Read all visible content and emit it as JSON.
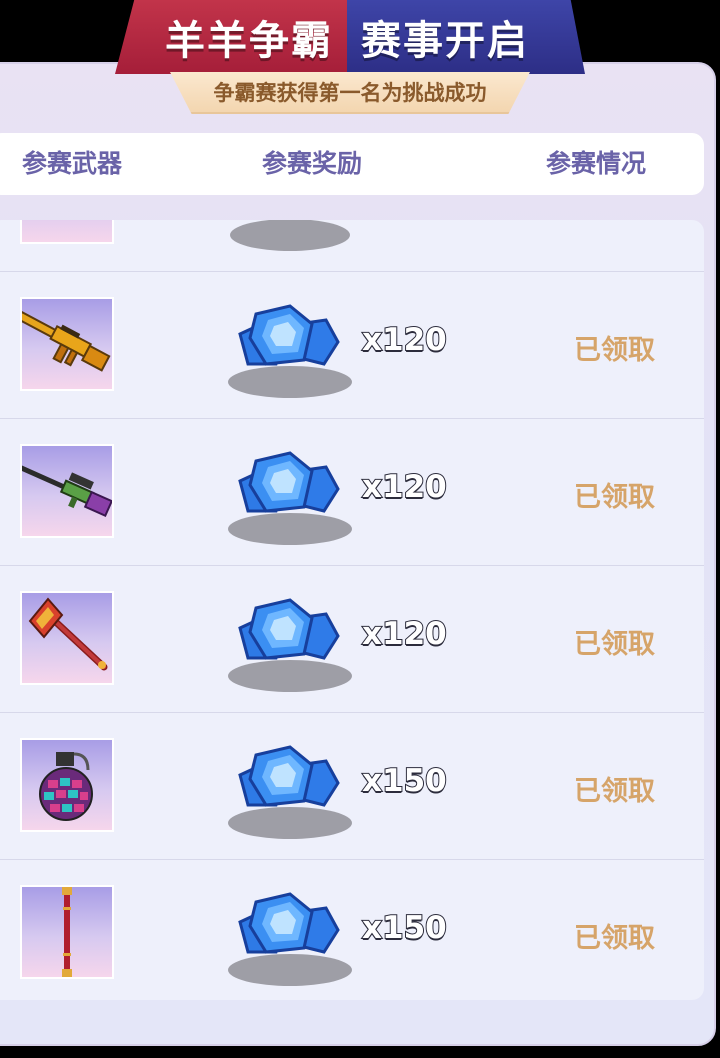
{
  "banner": {
    "title_left": "羊羊争霸",
    "title_right": "赛事开启",
    "subtitle": "争霸赛获得第一名为挑战成功"
  },
  "header": {
    "col_weapon": "参赛武器",
    "col_reward": "参赛奖励",
    "col_status": "参赛情况"
  },
  "rows": [
    {
      "weapon": "rifle-icon",
      "reward_icon": "blue-gem-icon",
      "quantity": "x120",
      "status": "已领取"
    },
    {
      "weapon": "sniper-rifle-icon",
      "reward_icon": "blue-gem-icon",
      "quantity": "x120",
      "status": "已领取"
    },
    {
      "weapon": "axe-icon",
      "reward_icon": "blue-gem-icon",
      "quantity": "x120",
      "status": "已领取"
    },
    {
      "weapon": "grenade-icon",
      "reward_icon": "blue-gem-icon",
      "quantity": "x150",
      "status": "已领取"
    },
    {
      "weapon": "staff-icon",
      "reward_icon": "blue-gem-icon",
      "quantity": "x150",
      "status": "已领取"
    }
  ],
  "colors": {
    "banner_red": "#a51e39",
    "banner_blue": "#2d2e86",
    "header_text": "#6a63a8",
    "status_text": "#d6a469"
  }
}
